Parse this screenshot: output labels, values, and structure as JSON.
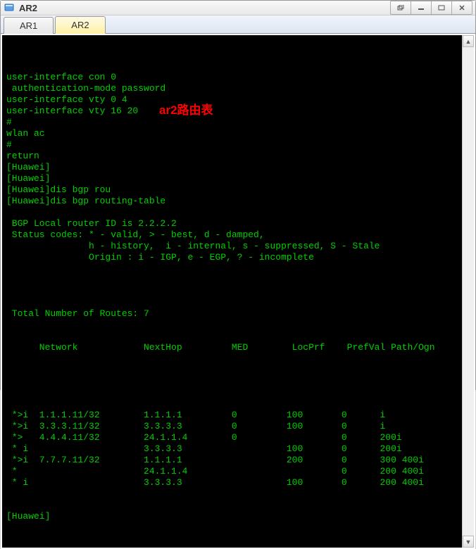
{
  "window": {
    "title": "AR2"
  },
  "tabs": [
    {
      "label": "AR1",
      "active": false
    },
    {
      "label": "AR2",
      "active": true
    }
  ],
  "annotation": "ar2路由表",
  "config_lines": [
    "user-interface con 0",
    " authentication-mode password",
    "user-interface vty 0 4",
    "user-interface vty 16 20",
    "#",
    "wlan ac",
    "#",
    "return",
    "[Huawei]",
    "[Huawei]",
    "[Huawei]dis bgp rou",
    "[Huawei]dis bgp routing-table",
    "",
    " BGP Local router ID is 2.2.2.2",
    " Status codes: * - valid, > - best, d - damped,",
    "               h - history,  i - internal, s - suppressed, S - Stale",
    "               Origin : i - IGP, e - EGP, ? - incomplete",
    "",
    ""
  ],
  "routes_total_line": " Total Number of Routes: 7",
  "routes_header": {
    "network": "Network",
    "nexthop": "NextHop",
    "med": "MED",
    "locprf": "LocPrf",
    "prefval": "PrefVal",
    "pathogn": "Path/Ogn"
  },
  "routes": [
    {
      "flag": " *>i",
      "network": "1.1.1.11/32",
      "nexthop": "1.1.1.1",
      "med": "0",
      "locprf": "100",
      "prefval": "0",
      "pathogn": "i"
    },
    {
      "flag": " *>i",
      "network": "3.3.3.11/32",
      "nexthop": "3.3.3.3",
      "med": "0",
      "locprf": "100",
      "prefval": "0",
      "pathogn": "i"
    },
    {
      "flag": " *>",
      "network": "4.4.4.11/32",
      "nexthop": "24.1.1.4",
      "med": "0",
      "locprf": "",
      "prefval": "0",
      "pathogn": "200i"
    },
    {
      "flag": " * i",
      "network": "",
      "nexthop": "3.3.3.3",
      "med": "",
      "locprf": "100",
      "prefval": "0",
      "pathogn": "200i"
    },
    {
      "flag": " *>i",
      "network": "7.7.7.11/32",
      "nexthop": "1.1.1.1",
      "med": "",
      "locprf": "200",
      "prefval": "0",
      "pathogn": "300 400i"
    },
    {
      "flag": " *",
      "network": "",
      "nexthop": "24.1.1.4",
      "med": "",
      "locprf": "",
      "prefval": "0",
      "pathogn": "200 400i"
    },
    {
      "flag": " * i",
      "network": "",
      "nexthop": "3.3.3.3",
      "med": "",
      "locprf": "100",
      "prefval": "0",
      "pathogn": "200 400i"
    }
  ],
  "final_prompt": "[Huawei]"
}
